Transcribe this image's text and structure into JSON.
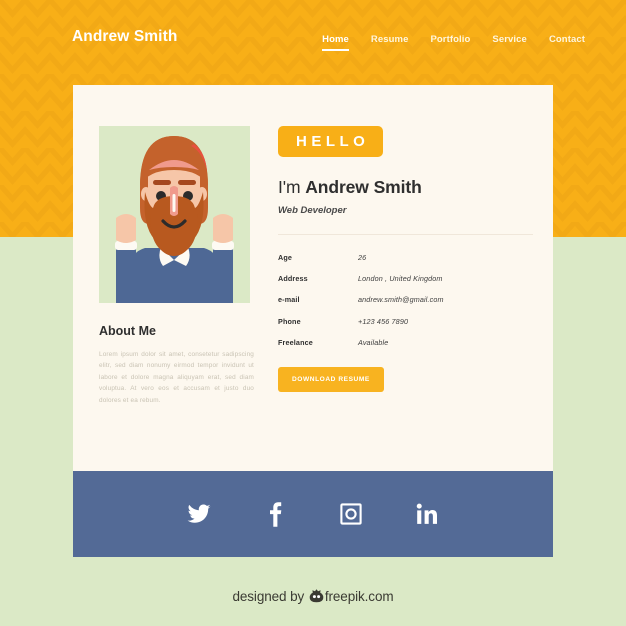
{
  "header": {
    "site_title": "Andrew Smith",
    "nav": [
      {
        "label": "Home",
        "active": true
      },
      {
        "label": "Resume",
        "active": false
      },
      {
        "label": "Portfolio",
        "active": false
      },
      {
        "label": "Service",
        "active": false
      },
      {
        "label": "Contact",
        "active": false
      }
    ]
  },
  "card": {
    "hello_badge": "HELLO",
    "intro_prefix": "I'm ",
    "intro_name": "Andrew Smith",
    "role": "Web Developer",
    "about_title": "About Me",
    "about_text": "Lorem ipsum dolor sit amet, consetetur sadipscing elitr, sed diam nonumy eirmod tempor invidunt ut labore et dolore magna aliquyam erat, sed diam voluptua. At vero eos et accusam et justo duo dolores et ea rebum.",
    "info": [
      {
        "label": "Age",
        "value": "26"
      },
      {
        "label": "Address",
        "value": "London , United Kingdom"
      },
      {
        "label": "e-mail",
        "value": "andrew.smith@gmail.com"
      },
      {
        "label": "Phone",
        "value": "+123 456 7890"
      },
      {
        "label": "Freelance",
        "value": "Available"
      }
    ],
    "download_label": "DOWNLOAD RESUME"
  },
  "social": [
    {
      "name": "twitter"
    },
    {
      "name": "facebook"
    },
    {
      "name": "instagram"
    },
    {
      "name": "linkedin"
    }
  ],
  "credit": {
    "prefix": "designed by ",
    "suffix": "freepik.com"
  },
  "colors": {
    "orange": "#f8af17",
    "orange_button": "#f8b320",
    "page_green": "#dbe9c6",
    "card_cream": "#fdf8ef",
    "footer_blue": "#536a96",
    "text_dark": "#2f2f2f",
    "about_text": "#c9c3b4"
  }
}
